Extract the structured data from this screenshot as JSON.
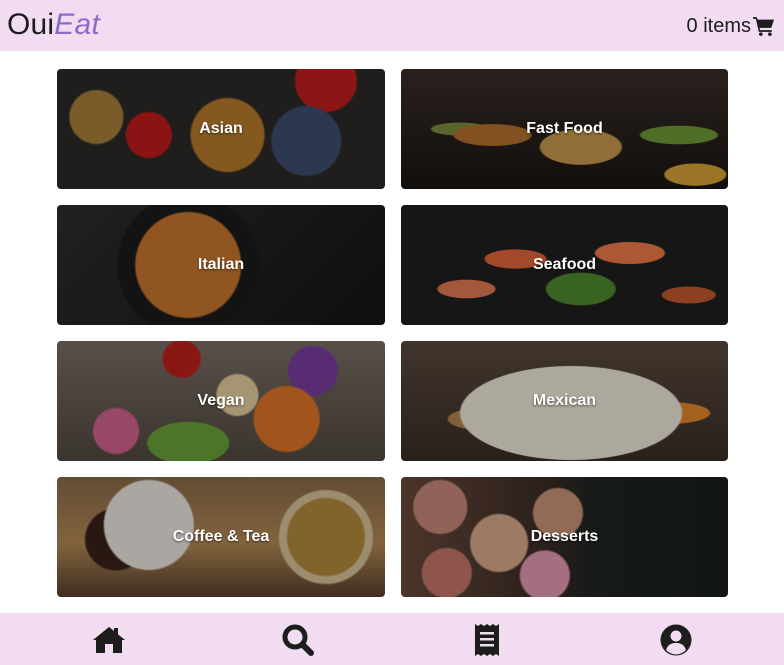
{
  "header": {
    "logo_part1": "Oui",
    "logo_part2": "Eat",
    "cart_label": "0 items",
    "cart_icon": "shopping-cart-icon"
  },
  "categories": [
    {
      "label": "Asian"
    },
    {
      "label": "Fast Food"
    },
    {
      "label": "Italian"
    },
    {
      "label": "Seafood"
    },
    {
      "label": "Vegan"
    },
    {
      "label": "Mexican"
    },
    {
      "label": "Coffee & Tea"
    },
    {
      "label": "Desserts"
    }
  ],
  "footer_nav": [
    {
      "icon": "home-icon"
    },
    {
      "icon": "search-icon"
    },
    {
      "icon": "receipt-icon"
    },
    {
      "icon": "user-circle-icon"
    }
  ],
  "colors": {
    "header_bg": "#f2dcf2",
    "logo_accent": "#8b6cc9",
    "text": "#1d1d1d"
  }
}
